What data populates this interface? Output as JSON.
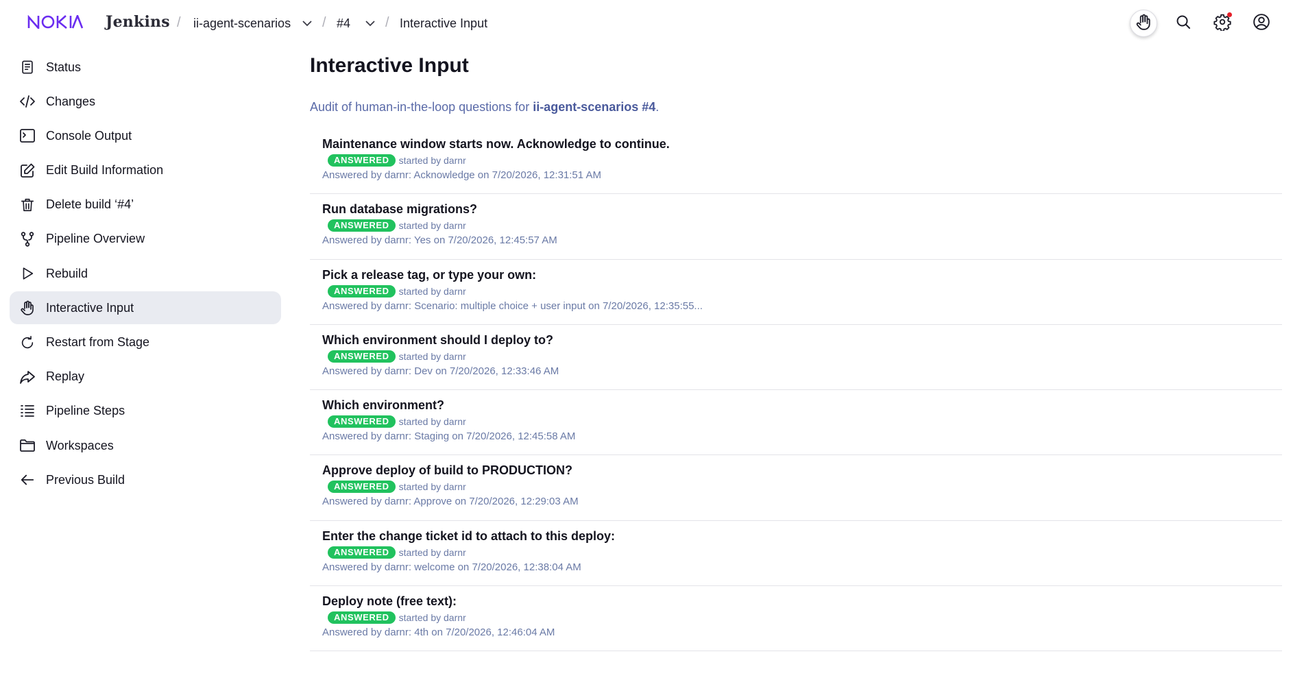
{
  "header": {
    "logo_text": "NOKIA",
    "app_name": "Jenkins",
    "breadcrumbs": [
      {
        "label": "ii-agent-scenarios",
        "has_dropdown": true
      },
      {
        "label": "#4",
        "has_dropdown": true
      },
      {
        "label": "Interactive Input",
        "has_dropdown": false
      }
    ],
    "actions": [
      {
        "icon": "hand-icon",
        "active": true
      },
      {
        "icon": "search-icon"
      },
      {
        "icon": "gear-icon",
        "notification": true,
        "notification_color": "#e5202a"
      },
      {
        "icon": "user-icon"
      }
    ]
  },
  "sidebar": {
    "items": [
      {
        "label": "Status",
        "icon": "status-icon"
      },
      {
        "label": "Changes",
        "icon": "code-icon"
      },
      {
        "label": "Console Output",
        "icon": "terminal-icon"
      },
      {
        "label": "Edit Build Information",
        "icon": "edit-icon"
      },
      {
        "label": "Delete build ‘#4’",
        "icon": "trash-icon"
      },
      {
        "label": "Pipeline Overview",
        "icon": "branch-icon"
      },
      {
        "label": "Rebuild",
        "icon": "play-icon"
      },
      {
        "label": "Interactive Input",
        "icon": "hand-icon",
        "active": true
      },
      {
        "label": "Restart from Stage",
        "icon": "restart-icon"
      },
      {
        "label": "Replay",
        "icon": "replay-icon"
      },
      {
        "label": "Pipeline Steps",
        "icon": "list-icon"
      },
      {
        "label": "Workspaces",
        "icon": "folder-icon"
      },
      {
        "label": "Previous Build",
        "icon": "arrow-left-icon"
      }
    ]
  },
  "main": {
    "title": "Interactive Input",
    "subtitle_prefix": "Audit of human-in-the-loop questions for ",
    "subtitle_link": "ii-agent-scenarios #4",
    "subtitle_suffix": ".",
    "badge_label": "ANSWERED",
    "badge_color": "#21c25e",
    "entries": [
      {
        "question": "Maintenance window starts now. Acknowledge to continue.",
        "started": "started by darnr",
        "answer": "Answered by darnr: Acknowledge on 7/20/2026, 12:31:51 AM"
      },
      {
        "question": "Run database migrations?",
        "started": "started by darnr",
        "answer": "Answered by darnr: Yes on 7/20/2026, 12:45:57 AM"
      },
      {
        "question": "Pick a release tag, or type your own:",
        "started": "started by darnr",
        "answer": "Answered by darnr: Scenario: multiple choice + user input on 7/20/2026, 12:35:55..."
      },
      {
        "question": "Which environment should I deploy to?",
        "started": "started by darnr",
        "answer": "Answered by darnr: Dev on 7/20/2026, 12:33:46 AM"
      },
      {
        "question": "Which environment?",
        "started": "started by darnr",
        "answer": "Answered by darnr: Staging on 7/20/2026, 12:45:58 AM"
      },
      {
        "question": "Approve deploy of build to PRODUCTION?",
        "started": "started by darnr",
        "answer": "Answered by darnr: Approve on 7/20/2026, 12:29:03 AM"
      },
      {
        "question": "Enter the change ticket id to attach to this deploy:",
        "started": "started by darnr",
        "answer": "Answered by darnr: welcome on 7/20/2026, 12:38:04 AM"
      },
      {
        "question": "Deploy note (free text):",
        "started": "started by darnr",
        "answer": "Answered by darnr: 4th on 7/20/2026, 12:46:04 AM"
      }
    ]
  }
}
